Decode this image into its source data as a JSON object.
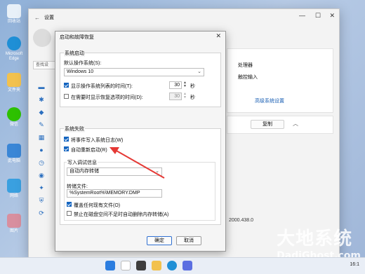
{
  "desktop": {
    "icons": [
      {
        "label": "回收站",
        "color": "#e8f0f8"
      },
      {
        "label": "Microsoft Edge",
        "color": "#1f8fd6"
      },
      {
        "label": "文件夹",
        "color": "#f2c14e"
      },
      {
        "label": "微信",
        "color": "#2dc100"
      },
      {
        "label": "此电脑",
        "color": "#3a86d6"
      },
      {
        "label": "网络",
        "color": "#3aa0e0"
      },
      {
        "label": "图片",
        "color": "#d88f9f"
      }
    ]
  },
  "settings": {
    "title": "设置",
    "search_placeholder": "查找设",
    "panel": {
      "line1": "处理器",
      "line2": "触控输入",
      "advanced_link": "高级系统设置",
      "copy_button": "复制",
      "version": "2000.438.0"
    }
  },
  "dialog": {
    "title": "启动和故障恢复",
    "startup": {
      "group_label": "系统启动",
      "default_os_label": "默认操作系统(S):",
      "default_os_value": "Windows 10",
      "show_os_list_label": "显示操作系统列表的时间(T):",
      "show_os_list_value": "30",
      "show_recovery_label": "在需要时显示恢复选项的时间(D):",
      "show_recovery_value": "30",
      "seconds_unit": "秒"
    },
    "failure": {
      "group_label": "系统失败",
      "write_event_label": "将事件写入系统日志(W)",
      "auto_restart_label": "自动重新启动(R)",
      "debug_info_label": "写入调试信息",
      "debug_info_value": "自动内存转储",
      "dump_file_label": "转储文件:",
      "dump_file_value": "%SystemRoot%\\MEMORY.DMP",
      "overwrite_label": "覆盖任何现有文件(O)",
      "disable_autodelete_label": "禁止在磁盘空间不足时自动删除内存转储(A)"
    },
    "buttons": {
      "ok": "确定",
      "cancel": "取消"
    }
  },
  "taskbar": {
    "icons": [
      "start-icon",
      "search-icon",
      "task-view-icon",
      "file-explorer-icon",
      "edge-icon",
      "store-icon"
    ],
    "time": "16:1"
  },
  "watermark": {
    "line1": "大地系统",
    "line2": "DadiGhost.com"
  },
  "colors": {
    "accent": "#1565c0",
    "arrow": "#e53935"
  }
}
